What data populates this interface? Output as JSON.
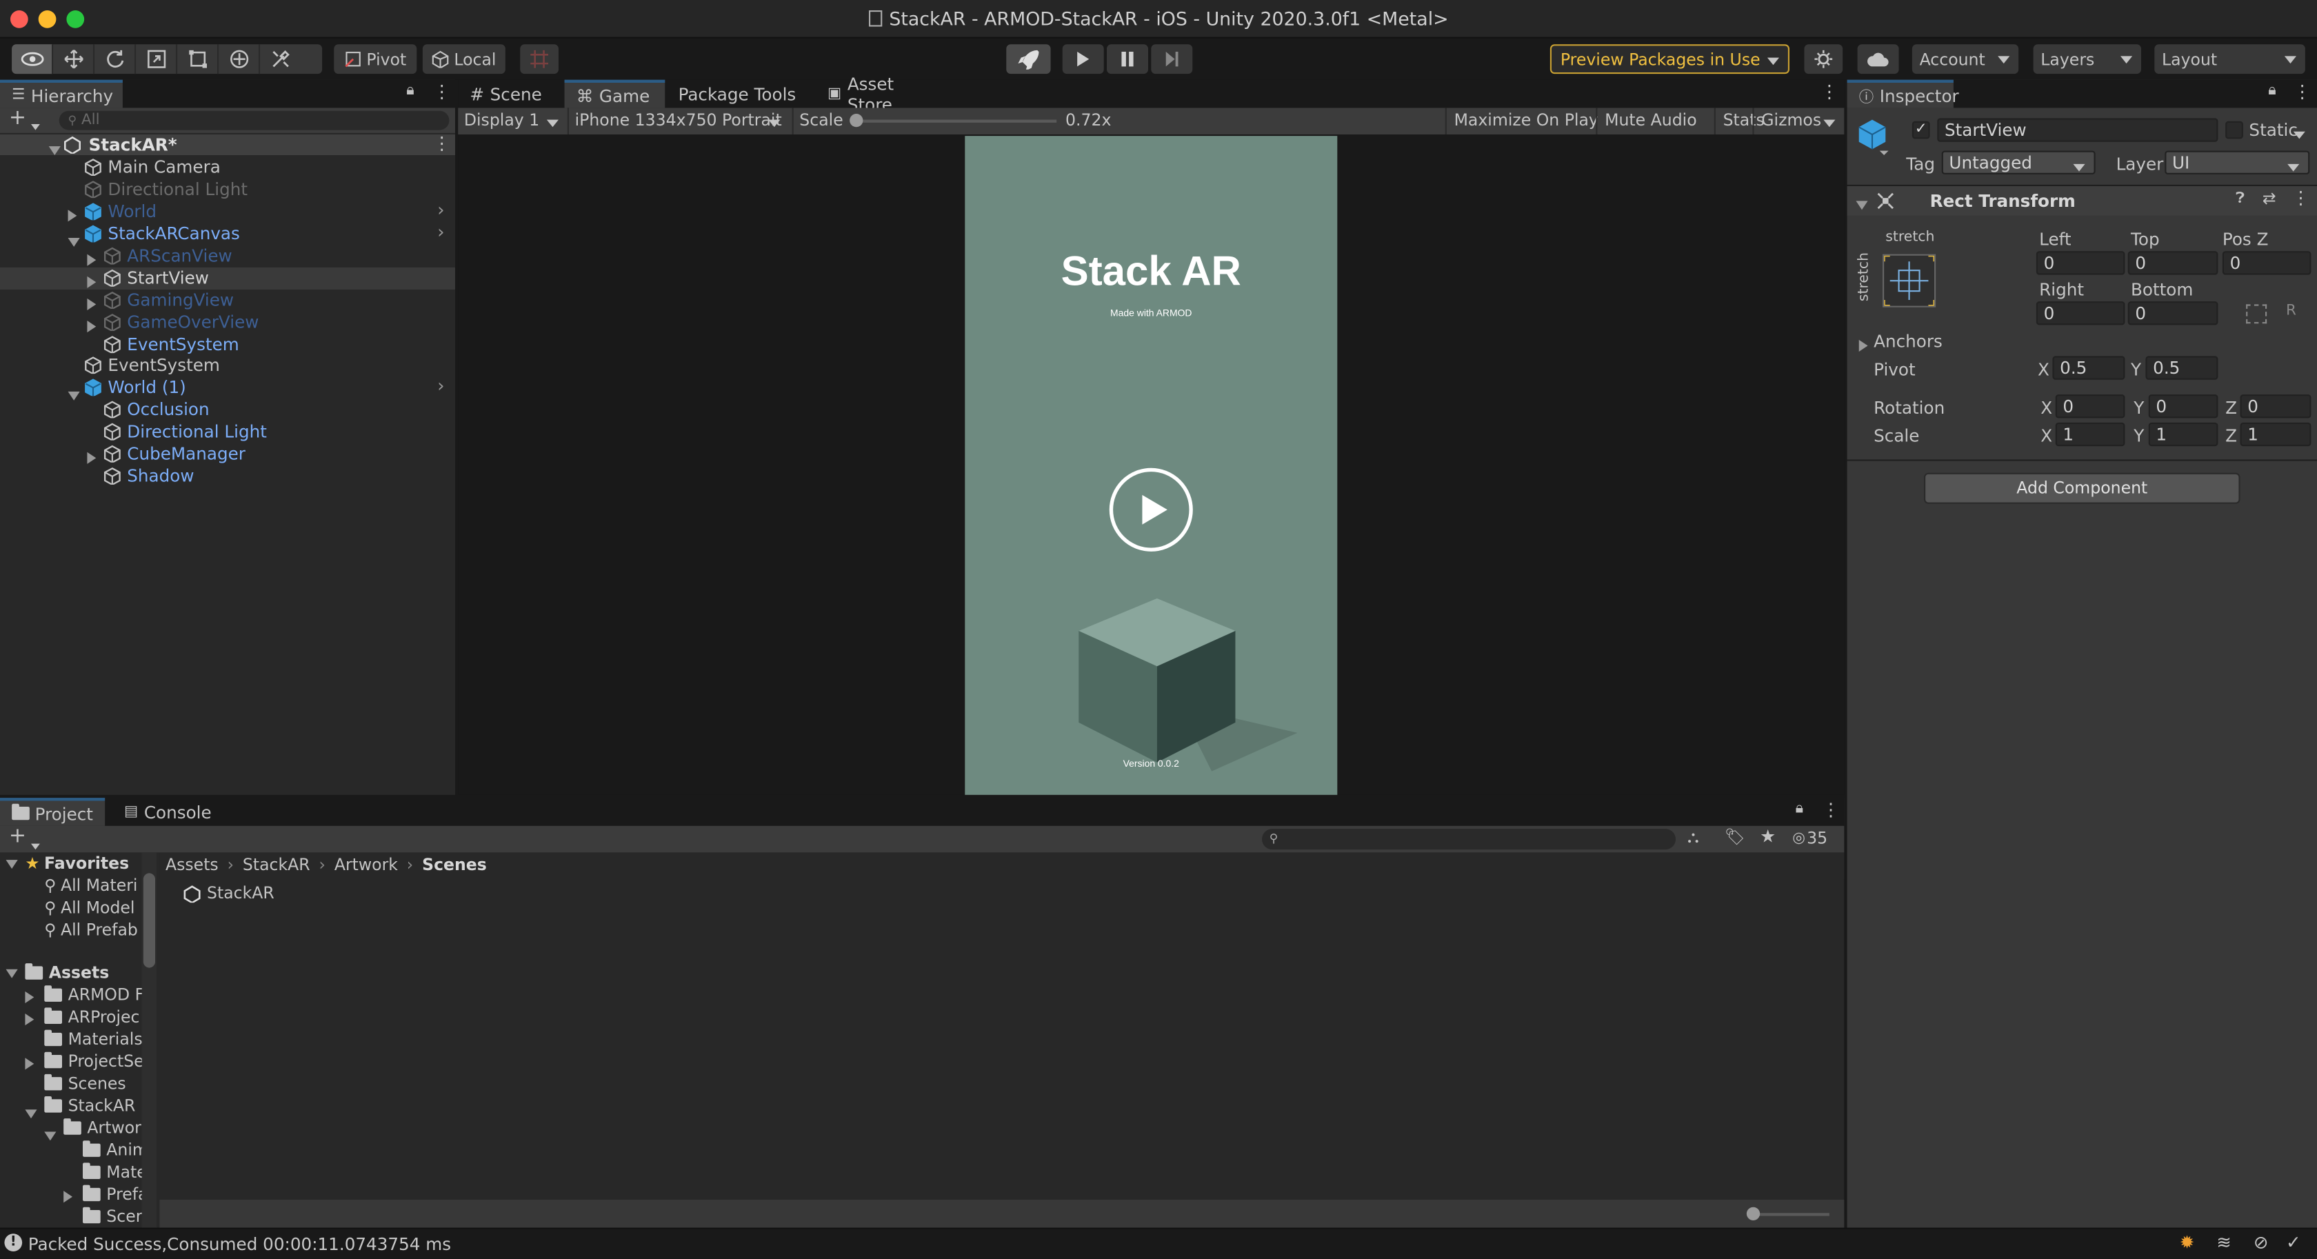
{
  "window": {
    "title": "StackAR - ARMOD-StackAR - iOS - Unity 2020.3.0f1 <Metal>"
  },
  "toolbar": {
    "pivot_label": "Pivot",
    "local_label": "Local",
    "preview_packages_label": "Preview Packages in Use",
    "account_label": "Account",
    "layers_label": "Layers",
    "layout_label": "Layout"
  },
  "hierarchy": {
    "tab_label": "Hierarchy",
    "search_placeholder": "All",
    "scene_name": "StackAR*",
    "items": [
      {
        "label": "Main Camera",
        "color": "#c4c4c4"
      },
      {
        "label": "Directional Light",
        "color": "#6b6b6b"
      },
      {
        "label": "World",
        "color": "#3d5f94"
      },
      {
        "label": "StackARCanvas",
        "color": "#7cadf7"
      },
      {
        "label": "ARScanView",
        "color": "#3d5f94"
      },
      {
        "label": "StartView",
        "color": "#d2d2d2"
      },
      {
        "label": "GamingView",
        "color": "#3d5f94"
      },
      {
        "label": "GameOverView",
        "color": "#3d5f94"
      },
      {
        "label": "EventSystem",
        "color": "#7cadf7"
      },
      {
        "label": "EventSystem",
        "color": "#c4c4c4"
      },
      {
        "label": "World (1)",
        "color": "#7cadf7"
      },
      {
        "label": "Occlusion",
        "color": "#7cadf7"
      },
      {
        "label": "Directional Light",
        "color": "#7cadf7"
      },
      {
        "label": "CubeManager",
        "color": "#7cadf7"
      },
      {
        "label": "Shadow",
        "color": "#7cadf7"
      }
    ]
  },
  "game": {
    "tabs": [
      "Scene",
      "Game",
      "Package Tools",
      "Asset Store"
    ],
    "display_label": "Display 1",
    "resolution_label": "iPhone 1334x750 Portrait",
    "scale_label": "Scale",
    "scale_value": "0.72x",
    "maximize_label": "Maximize On Play",
    "mute_label": "Mute Audio",
    "stats_label": "Stats",
    "gizmos_label": "Gizmos",
    "viewport": {
      "title": "Stack AR",
      "subtitle": "Made with ARMOD",
      "version": "Version 0.0.2",
      "bg_color": "#6e8a80"
    }
  },
  "inspector": {
    "tab_label": "Inspector",
    "object_name": "StartView",
    "static_label": "Static",
    "tag_label": "Tag",
    "tag_value": "Untagged",
    "layer_label": "Layer",
    "layer_value": "UI",
    "component_title": "Rect Transform",
    "stretch_top_label": "stretch",
    "stretch_side_label": "stretch",
    "left_label": "Left",
    "left_value": "0",
    "top_label": "Top",
    "top_value": "0",
    "posz_label": "Pos Z",
    "posz_value": "0",
    "right_label": "Right",
    "right_value": "0",
    "bottom_label": "Bottom",
    "bottom_value": "0",
    "r_label": "R",
    "anchors_label": "Anchors",
    "pivot_label": "Pivot",
    "pivot_x": "0.5",
    "pivot_y": "0.5",
    "rotation_label": "Rotation",
    "rot_x": "0",
    "rot_y": "0",
    "rot_z": "0",
    "scale_label": "Scale",
    "scale_x": "1",
    "scale_y": "1",
    "scale_z": "1",
    "x_label": "X",
    "y_label": "Y",
    "z_label": "Z",
    "add_component_label": "Add Component"
  },
  "project": {
    "tabs": [
      "Project",
      "Console"
    ],
    "hidden_count": "35",
    "favorites_label": "Favorites",
    "favorites": [
      "All Materi",
      "All Model",
      "All Prefab"
    ],
    "assets_label": "Assets",
    "tree": [
      "ARMOD F",
      "ARProjec",
      "Materials",
      "ProjectSe",
      "Scenes",
      "StackAR",
      "Artworl",
      "Anim",
      "Mate",
      "Prefa",
      "Scer"
    ],
    "breadcrumb": [
      "Assets",
      "StackAR",
      "Artwork",
      "Scenes"
    ],
    "files": [
      "StackAR"
    ]
  },
  "status": {
    "message": "Packed Success,Consumed 00:00:11.0743754 ms"
  }
}
